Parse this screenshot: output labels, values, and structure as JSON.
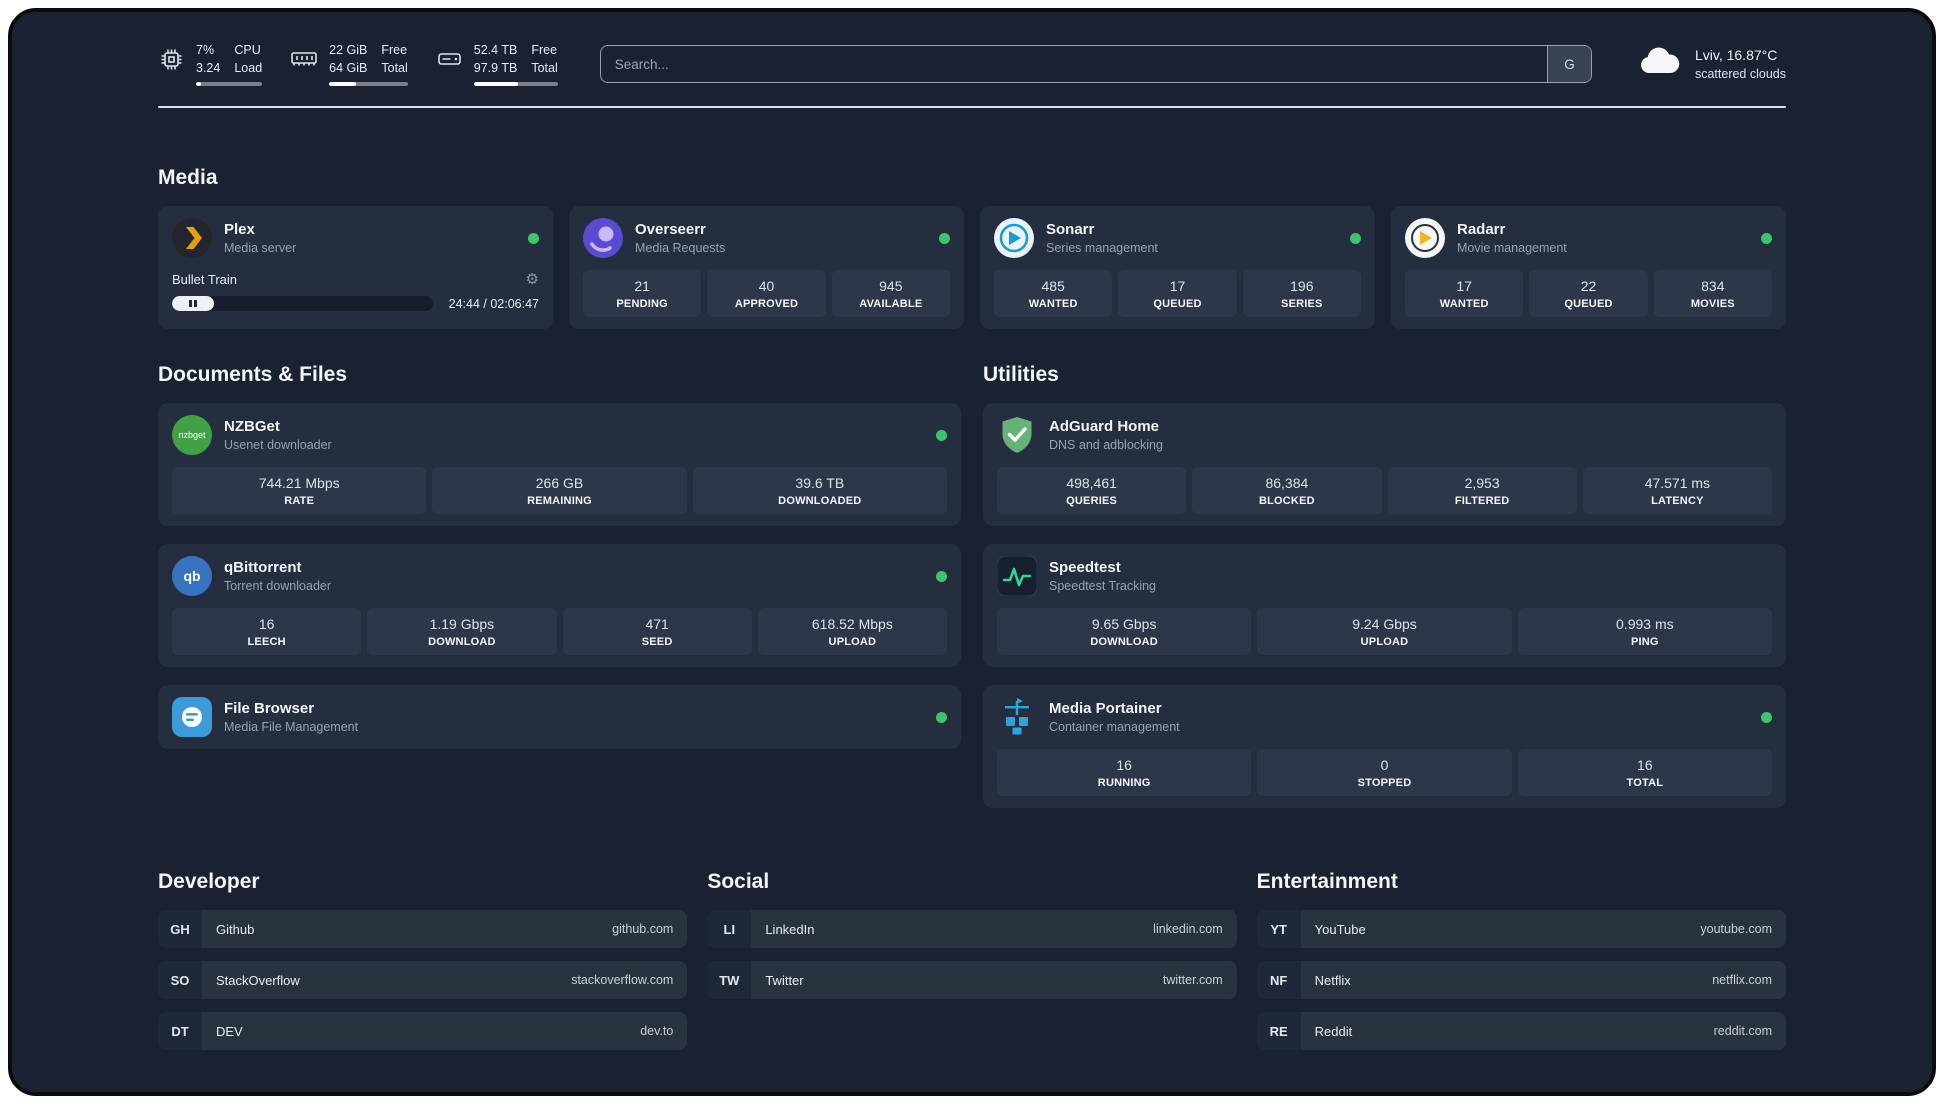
{
  "topbar": {
    "metrics": [
      {
        "line1": "7%",
        "line2": "3.24",
        "label1": "CPU",
        "label2": "Load",
        "meter_percent": 8
      },
      {
        "line1": "22 GiB",
        "line2": "64 GiB",
        "label1": "Free",
        "label2": "Total",
        "meter_percent": 34
      },
      {
        "line1": "52.4 TB",
        "line2": "97.9 TB",
        "label1": "Free",
        "label2": "Total",
        "meter_percent": 53
      }
    ],
    "search": {
      "placeholder": "Search...",
      "engine_badge": "G"
    },
    "weather": {
      "location": "Lviv, 16.87°C",
      "condition": "scattered clouds"
    }
  },
  "media": {
    "title": "Media",
    "cards": [
      {
        "title": "Plex",
        "subtitle": "Media server",
        "status": "online",
        "player": {
          "track": "Bullet Train",
          "time": "24:44 / 02:06:47",
          "progress_percent": 16
        }
      },
      {
        "title": "Overseerr",
        "subtitle": "Media Requests",
        "status": "online",
        "stats": [
          {
            "value": "21",
            "label": "PENDING"
          },
          {
            "value": "40",
            "label": "APPROVED"
          },
          {
            "value": "945",
            "label": "AVAILABLE"
          }
        ]
      },
      {
        "title": "Sonarr",
        "subtitle": "Series management",
        "status": "online",
        "stats": [
          {
            "value": "485",
            "label": "WANTED"
          },
          {
            "value": "17",
            "label": "QUEUED"
          },
          {
            "value": "196",
            "label": "SERIES"
          }
        ]
      },
      {
        "title": "Radarr",
        "subtitle": "Movie management",
        "status": "online",
        "stats": [
          {
            "value": "17",
            "label": "WANTED"
          },
          {
            "value": "22",
            "label": "QUEUED"
          },
          {
            "value": "834",
            "label": "MOVIES"
          }
        ]
      }
    ]
  },
  "documents": {
    "title": "Documents & Files",
    "cards": [
      {
        "title": "NZBGet",
        "subtitle": "Usenet downloader",
        "status": "online",
        "stats": [
          {
            "value": "744.21 Mbps",
            "label": "RATE"
          },
          {
            "value": "266 GB",
            "label": "REMAINING"
          },
          {
            "value": "39.6 TB",
            "label": "DOWNLOADED"
          }
        ]
      },
      {
        "title": "qBittorrent",
        "subtitle": "Torrent downloader",
        "status": "online",
        "stats": [
          {
            "value": "16",
            "label": "LEECH"
          },
          {
            "value": "1.19 Gbps",
            "label": "DOWNLOAD"
          },
          {
            "value": "471",
            "label": "SEED"
          },
          {
            "value": "618.52 Mbps",
            "label": "UPLOAD"
          }
        ]
      },
      {
        "title": "File Browser",
        "subtitle": "Media File Management",
        "status": "online"
      }
    ]
  },
  "utilities": {
    "title": "Utilities",
    "cards": [
      {
        "title": "AdGuard Home",
        "subtitle": "DNS and adblocking",
        "stats": [
          {
            "value": "498,461",
            "label": "QUERIES"
          },
          {
            "value": "86,384",
            "label": "BLOCKED"
          },
          {
            "value": "2,953",
            "label": "FILTERED"
          },
          {
            "value": "47.571 ms",
            "label": "LATENCY"
          }
        ]
      },
      {
        "title": "Speedtest",
        "subtitle": "Speedtest Tracking",
        "stats": [
          {
            "value": "9.65 Gbps",
            "label": "DOWNLOAD"
          },
          {
            "value": "9.24 Gbps",
            "label": "UPLOAD"
          },
          {
            "value": "0.993 ms",
            "label": "PING"
          }
        ]
      },
      {
        "title": "Media Portainer",
        "subtitle": "Container management",
        "status": "online",
        "stats": [
          {
            "value": "16",
            "label": "RUNNING"
          },
          {
            "value": "0",
            "label": "STOPPED"
          },
          {
            "value": "16",
            "label": "TOTAL"
          }
        ]
      }
    ]
  },
  "bookmarks": [
    {
      "title": "Developer",
      "items": [
        {
          "abbr": "GH",
          "name": "Github",
          "url": "github.com"
        },
        {
          "abbr": "SO",
          "name": "StackOverflow",
          "url": "stackoverflow.com"
        },
        {
          "abbr": "DT",
          "name": "DEV",
          "url": "dev.to"
        }
      ]
    },
    {
      "title": "Social",
      "items": [
        {
          "abbr": "LI",
          "name": "LinkedIn",
          "url": "linkedin.com"
        },
        {
          "abbr": "TW",
          "name": "Twitter",
          "url": "twitter.com"
        }
      ]
    },
    {
      "title": "Entertainment",
      "items": [
        {
          "abbr": "YT",
          "name": "YouTube",
          "url": "youtube.com"
        },
        {
          "abbr": "NF",
          "name": "Netflix",
          "url": "netflix.com"
        },
        {
          "abbr": "RE",
          "name": "Reddit",
          "url": "reddit.com"
        }
      ]
    }
  ],
  "colors": {
    "status_online": "#3ec46d",
    "plex_accent": "#e5a00d",
    "background": "#1a2232",
    "card": "#252e3e"
  }
}
